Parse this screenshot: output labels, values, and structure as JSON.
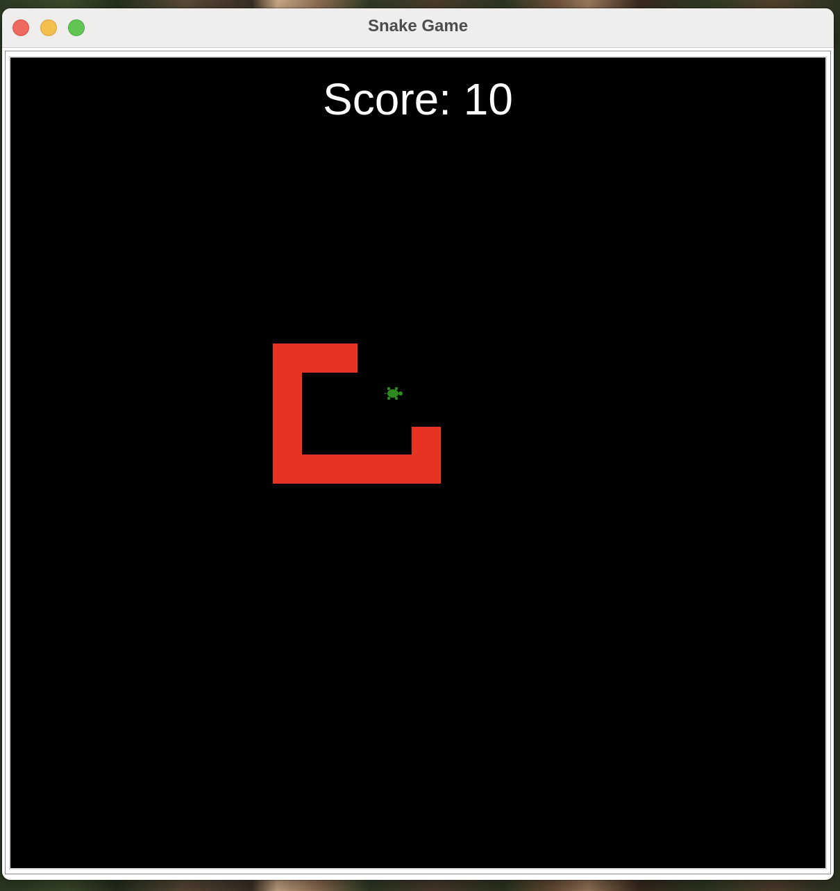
{
  "window": {
    "title": "Snake Game"
  },
  "game": {
    "score_text": "Score: 10",
    "colors": {
      "background": "#000000",
      "snake": "#e83323",
      "food": "#2d8a1e",
      "score_text": "#ffffff"
    },
    "snake_icon": "snake-body",
    "food_icon": "turtle-icon"
  }
}
